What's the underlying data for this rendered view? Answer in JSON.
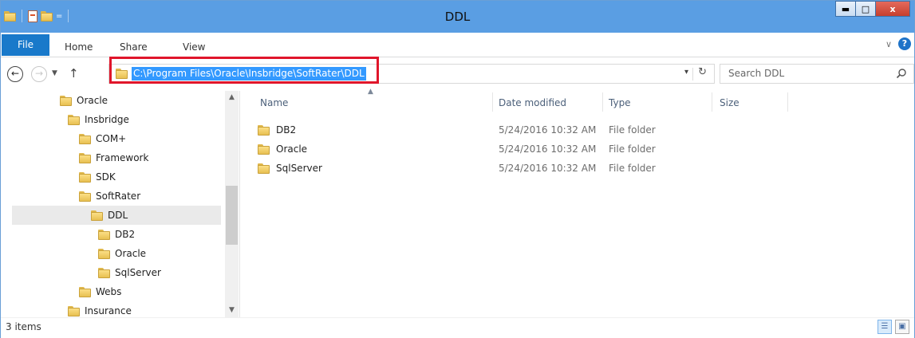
{
  "window": {
    "title": "DDL",
    "qat_dropdown": "=",
    "buttons": {
      "minimize": "▬",
      "maximize": "□",
      "close": "x"
    }
  },
  "ribbon": {
    "tabs": [
      "File",
      "Home",
      "Share",
      "View"
    ],
    "expand_icon": "chevron-down",
    "help_label": "?"
  },
  "address_bar": {
    "back": "←",
    "forward": "→",
    "up": "↑",
    "path": "C:\\Program Files\\Oracle\\Insbridge\\SoftRater\\DDL",
    "dropdown": "▾",
    "refresh": "↻"
  },
  "search": {
    "placeholder": "Search DDL"
  },
  "nav_tree": [
    {
      "label": "Oracle",
      "depth": 1
    },
    {
      "label": "Insbridge",
      "depth": 2
    },
    {
      "label": "COM+",
      "depth": 3
    },
    {
      "label": "Framework",
      "depth": 3
    },
    {
      "label": "SDK",
      "depth": 3
    },
    {
      "label": "SoftRater",
      "depth": 3
    },
    {
      "label": "DDL",
      "depth": 4,
      "selected": true
    },
    {
      "label": "DB2",
      "depth": 5
    },
    {
      "label": "Oracle",
      "depth": 5
    },
    {
      "label": "SqlServer",
      "depth": 5
    },
    {
      "label": "Webs",
      "depth": 3
    },
    {
      "label": "Insurance",
      "depth": 2
    }
  ],
  "file_list": {
    "columns": [
      "Name",
      "Date modified",
      "Type",
      "Size"
    ],
    "rows": [
      {
        "name": "DB2",
        "date": "5/24/2016 10:32 AM",
        "type": "File folder",
        "size": ""
      },
      {
        "name": "Oracle",
        "date": "5/24/2016 10:32 AM",
        "type": "File folder",
        "size": ""
      },
      {
        "name": "SqlServer",
        "date": "5/24/2016 10:32 AM",
        "type": "File folder",
        "size": ""
      }
    ]
  },
  "status": {
    "item_count": "3 items"
  },
  "colors": {
    "titlebar": "#5a9ee3",
    "file_tab": "#1979ca",
    "address_selection": "#3399ff",
    "highlight_box": "#e0162b"
  }
}
